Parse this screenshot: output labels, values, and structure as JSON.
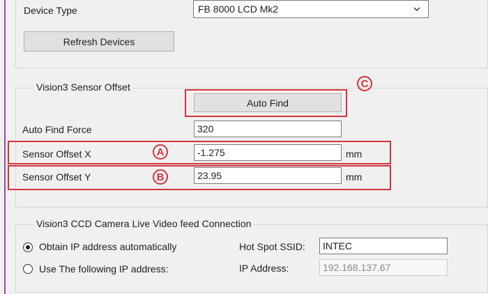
{
  "device": {
    "type_label": "Device Type",
    "selected": "FB 8000 LCD Mk2",
    "refresh_button": "Refresh Devices"
  },
  "sensor_offset": {
    "group_title": "Vision3 Sensor Offset",
    "auto_find_button": "Auto Find",
    "auto_find_force_label": "Auto Find Force",
    "auto_find_force_value": "320",
    "offset_x_label": "Sensor Offset X",
    "offset_x_value": "-1.275",
    "offset_x_unit": "mm",
    "offset_y_label": "Sensor Offset Y",
    "offset_y_value": "23.95",
    "offset_y_unit": "mm"
  },
  "camera": {
    "group_title": "Vision3 CCD Camera Live Video feed Connection",
    "radio_auto_label": "Obtain IP address automatically",
    "radio_manual_label": "Use The following IP address:",
    "hotspot_label": "Hot Spot SSID:",
    "hotspot_value": "INTEC",
    "ip_label": "IP Address:",
    "ip_value": "192.168.137.67"
  },
  "annotations": {
    "a": "A",
    "b": "B",
    "c": "C",
    "highlight_color": "#d1343d"
  }
}
